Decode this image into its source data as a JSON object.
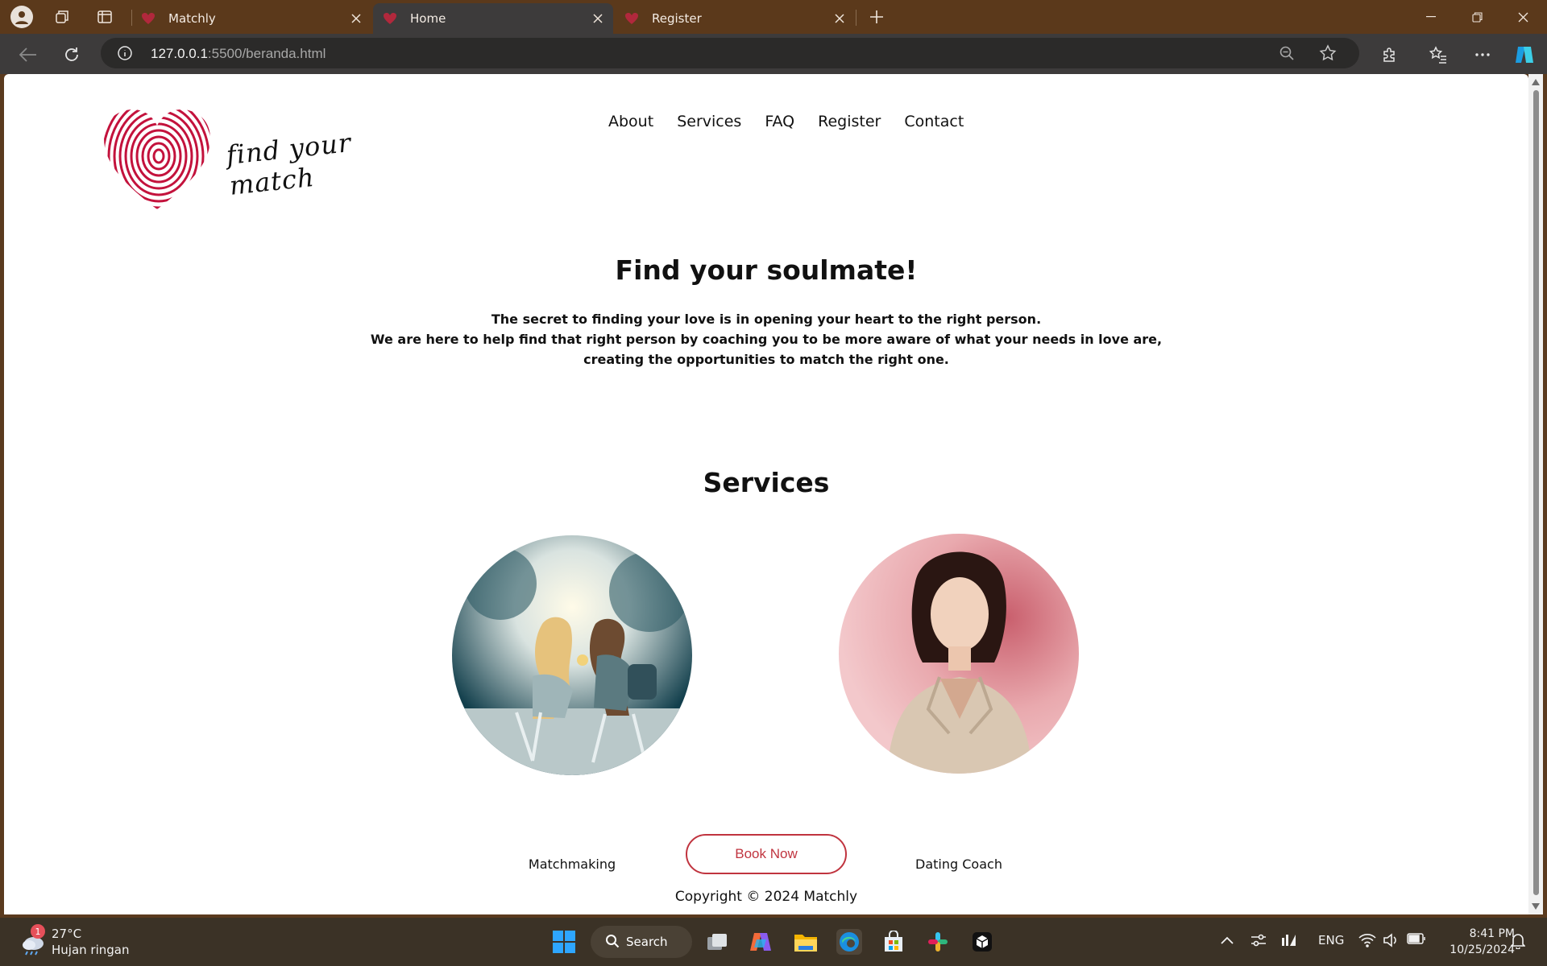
{
  "browser": {
    "tabs": [
      {
        "title": "Matchly",
        "active": false
      },
      {
        "title": "Home",
        "active": true
      },
      {
        "title": "Register",
        "active": false
      }
    ],
    "address": {
      "host": "127.0.0.1",
      "path": ":5500/beranda.html"
    }
  },
  "site": {
    "logo_text": "find your match",
    "nav": [
      "About",
      "Services",
      "FAQ",
      "Register",
      "Contact"
    ],
    "hero": {
      "title": "Find your soulmate!",
      "line1": "The secret to finding your love is in opening your heart to the right person.",
      "line2": "We are here to help find that right person by coaching you to be more aware of what your needs in love are,",
      "line3": "creating the opportunities to match the right one."
    },
    "services_title": "Services",
    "services": [
      {
        "label": "Matchmaking",
        "image": "couple-at-cafe-image"
      },
      {
        "label": "Dating Coach",
        "image": "coach-portrait-image"
      }
    ],
    "cta": "Book Now",
    "copyright": "Copyright © 2024 Matchly",
    "accent_color": "#c0343f"
  },
  "taskbar": {
    "weather_temp": "27°C",
    "weather_desc": "Hujan ringan",
    "weather_badge": "1",
    "search_label": "Search",
    "lang": "ENG",
    "time": "8:41 PM",
    "date": "10/25/2024"
  }
}
